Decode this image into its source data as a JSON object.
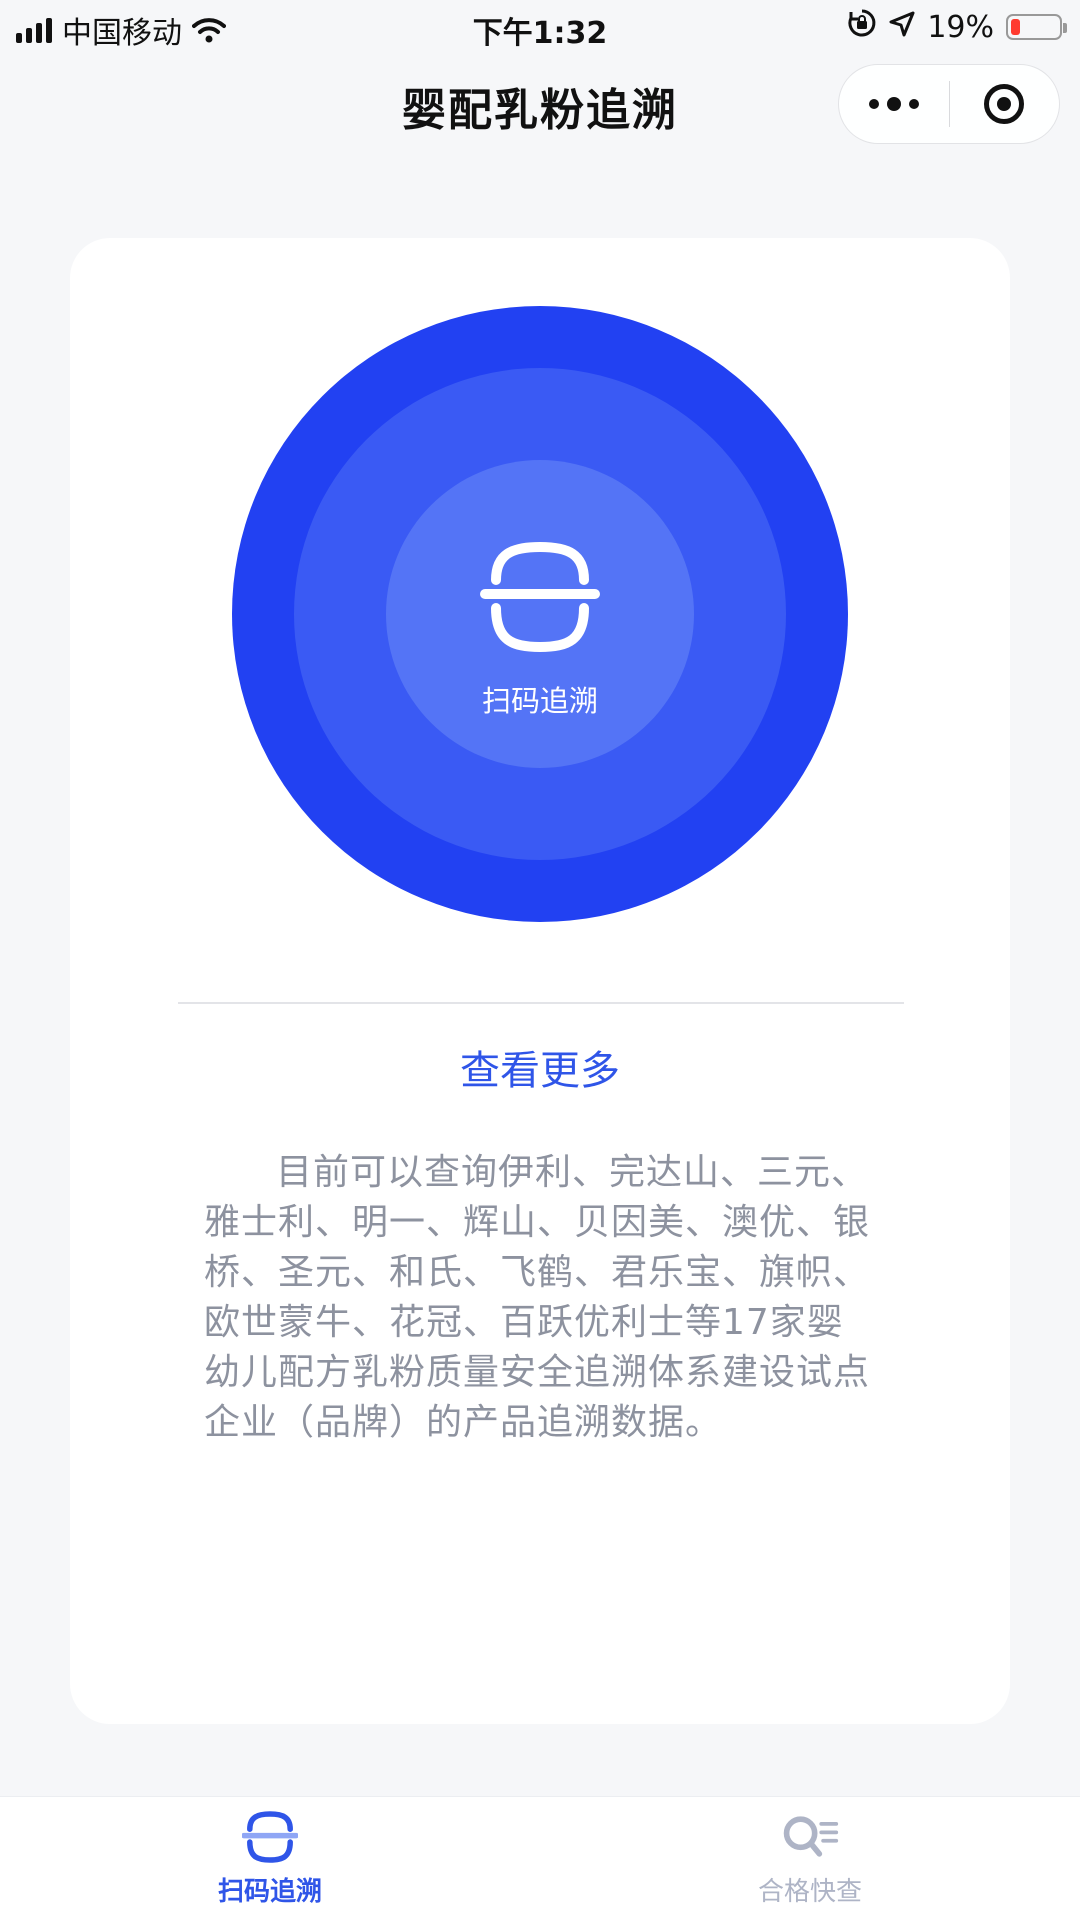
{
  "status_bar": {
    "carrier": "中国移动",
    "time": "下午1:32",
    "battery_percent": "19%",
    "battery_level": 0.19,
    "icons": [
      "signal-icon",
      "wifi-icon",
      "orientation-lock-icon",
      "location-icon",
      "battery-icon"
    ]
  },
  "nav": {
    "title": "婴配乳粉追溯",
    "capsule_icons": [
      "more-icon",
      "close-icon"
    ]
  },
  "main": {
    "scan_button_label": "扫码追溯",
    "view_more_label": "查看更多",
    "description": "目前可以查询伊利、完达山、三元、雅士利、明一、辉山、贝因美、澳优、银桥、圣元、和氏、飞鹤、君乐宝、旗帜、欧世蒙牛、花冠、百跃优利士等17家婴幼儿配方乳粉质量安全追溯体系建设试点企业（品牌）的产品追溯数据。"
  },
  "tab_bar": {
    "tabs": [
      {
        "label": "扫码追溯",
        "icon": "scan-icon",
        "active": true
      },
      {
        "label": "合格快查",
        "icon": "search-list-icon",
        "active": false
      }
    ]
  },
  "colors": {
    "primary": "#2f55e8",
    "circle_outer": "#2241f2",
    "circle_middle": "#3a5af4",
    "circle_inner": "#5474f6",
    "description_text": "#8d929f",
    "inactive_tab": "#aeb4c6",
    "background": "#f6f7f9"
  }
}
